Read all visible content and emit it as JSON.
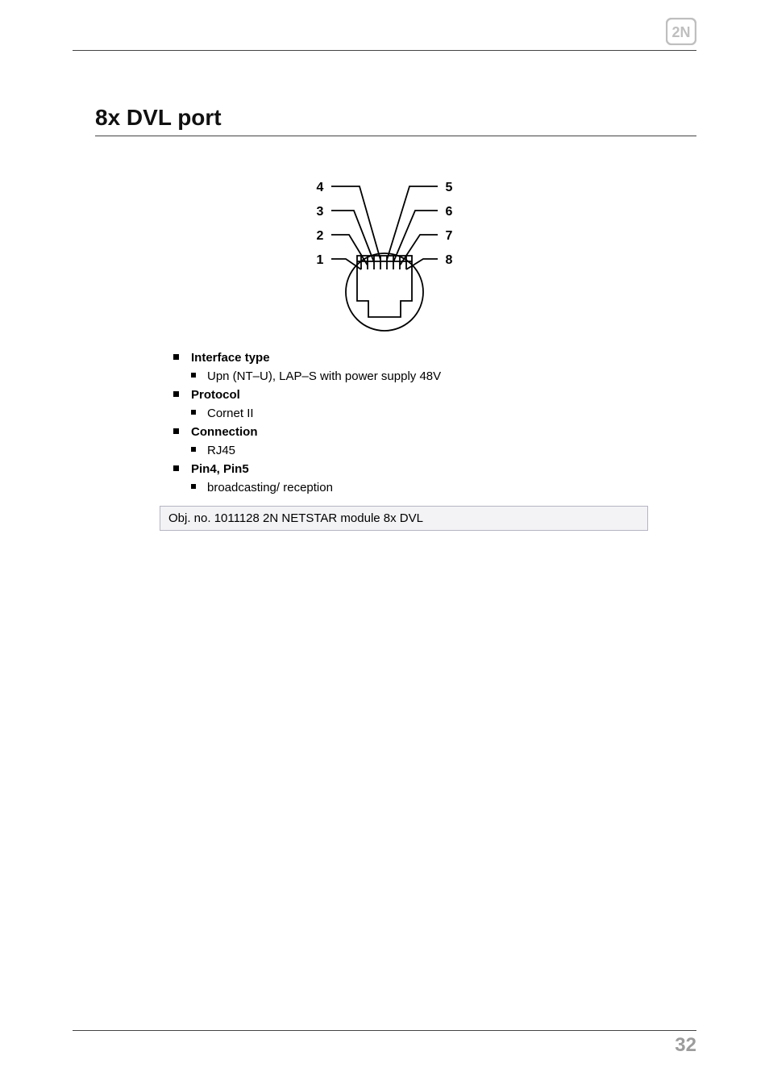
{
  "heading": "8x DVL port",
  "specs": [
    {
      "label": "Interface type",
      "items": [
        "Upn (NT–U), LAP–S with power supply 48V"
      ]
    },
    {
      "label": "Protocol",
      "items": [
        "Cornet II"
      ]
    },
    {
      "label": "Connection",
      "items": [
        "RJ45"
      ]
    },
    {
      "label": "Pin4, Pin5",
      "items": [
        "broadcasting/ reception"
      ]
    }
  ],
  "note": "Obj. no. 1011128 2N NETSTAR module 8x DVL",
  "page_number": "32",
  "diagram": {
    "pins": {
      "left": [
        "4",
        "3",
        "2",
        "1"
      ],
      "right": [
        "5",
        "6",
        "7",
        "8"
      ]
    }
  }
}
